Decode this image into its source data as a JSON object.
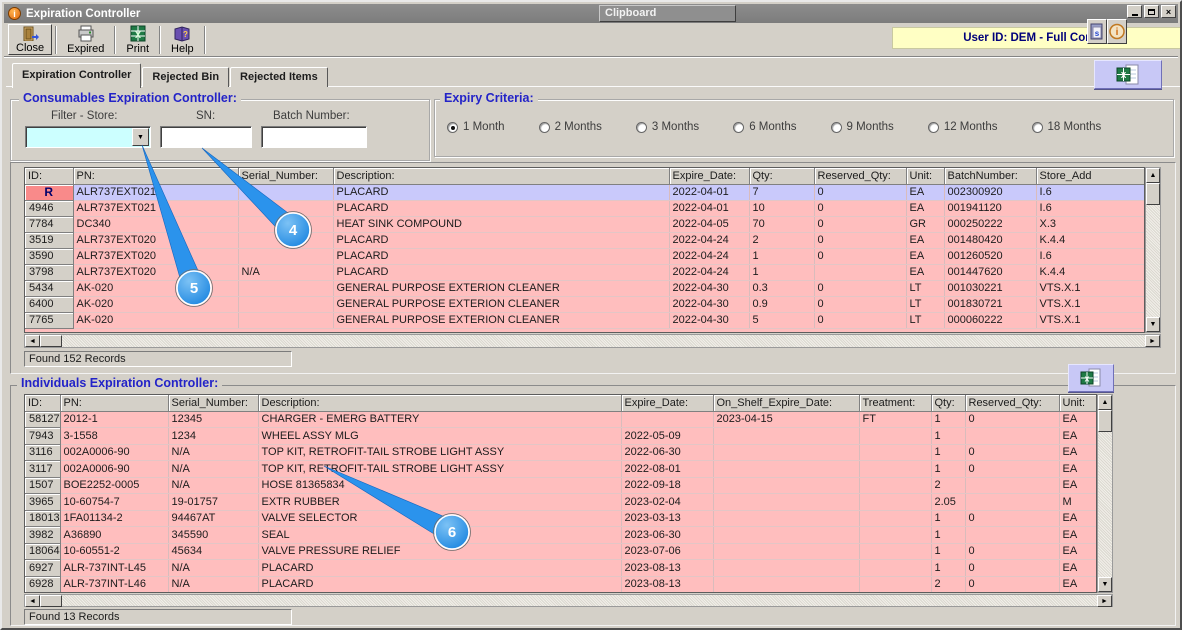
{
  "window": {
    "title": "Expiration Controller",
    "clipboard_title": "Clipboard",
    "user_badge": "User ID: DEM - Full Control"
  },
  "toolbar": {
    "buttons": [
      {
        "label": "Close",
        "icon": "door-exit-icon"
      },
      {
        "label": "Expired",
        "icon": "printer-icon"
      },
      {
        "label": "Print",
        "icon": "excel-icon"
      },
      {
        "label": "Help",
        "icon": "help-book-icon"
      }
    ]
  },
  "tabs": [
    {
      "label": "Expiration Controller",
      "cls": "active"
    },
    {
      "label": "Rejected Bin"
    },
    {
      "label": "Rejected Items"
    }
  ],
  "consumables": {
    "title": "Consumables Expiration Controller:",
    "store_label": "Filter - Store:",
    "store_value": "",
    "sn_label": "SN:",
    "sn_value": "",
    "batch_label": "Batch Number:",
    "batch_value": "",
    "status": "Found 152 Records",
    "columns": [
      "ID:",
      "PN:",
      "Serial_Number:",
      "Description:",
      "Expire_Date:",
      "Qty:",
      "Reserved_Qty:",
      "Unit:",
      "BatchNumber:",
      "Store_Add"
    ],
    "rows": [
      {
        "id": "R",
        "pn": "ALR737EXT021",
        "sn": "",
        "desc": "PLACARD",
        "exp": "2022-04-01",
        "qty": "7",
        "rq": "0",
        "unit": "EA",
        "batch": "002300920",
        "store": "I.6",
        "cls": "selected",
        "idcls": "red"
      },
      {
        "id": "4946",
        "pn": "ALR737EXT021",
        "sn": "",
        "desc": "PLACARD",
        "exp": "2022-04-01",
        "qty": "10",
        "rq": "0",
        "unit": "EA",
        "batch": "001941120",
        "store": "I.6"
      },
      {
        "id": "7784",
        "pn": "DC340",
        "sn": "",
        "desc": "HEAT SINK COMPOUND",
        "exp": "2022-04-05",
        "qty": "70",
        "rq": "0",
        "unit": "GR",
        "batch": "000250222",
        "store": "X.3"
      },
      {
        "id": "3519",
        "pn": "ALR737EXT020",
        "sn": "",
        "desc": "PLACARD",
        "exp": "2022-04-24",
        "qty": "2",
        "rq": "0",
        "unit": "EA",
        "batch": "001480420",
        "store": "K.4.4"
      },
      {
        "id": "3590",
        "pn": "ALR737EXT020",
        "sn": "",
        "desc": "PLACARD",
        "exp": "2022-04-24",
        "qty": "1",
        "rq": "0",
        "unit": "EA",
        "batch": "001260520",
        "store": "I.6"
      },
      {
        "id": "3798",
        "pn": "ALR737EXT020",
        "sn": "N/A",
        "desc": "PLACARD",
        "exp": "2022-04-24",
        "qty": "1",
        "rq": "",
        "unit": "EA",
        "batch": "001447620",
        "store": "K.4.4"
      },
      {
        "id": "5434",
        "pn": "AK-020",
        "sn": "",
        "desc": "GENERAL PURPOSE EXTERION CLEANER",
        "exp": "2022-04-30",
        "qty": "0.3",
        "rq": "0",
        "unit": "LT",
        "batch": "001030221",
        "store": "VTS.X.1"
      },
      {
        "id": "6400",
        "pn": "AK-020",
        "sn": "",
        "desc": "GENERAL PURPOSE EXTERION CLEANER",
        "exp": "2022-04-30",
        "qty": "0.9",
        "rq": "0",
        "unit": "LT",
        "batch": "001830721",
        "store": "VTS.X.1"
      },
      {
        "id": "7765",
        "pn": "AK-020",
        "sn": "",
        "desc": "GENERAL PURPOSE EXTERION CLEANER",
        "exp": "2022-04-30",
        "qty": "5",
        "rq": "0",
        "unit": "LT",
        "batch": "000060222",
        "store": "VTS.X.1"
      }
    ]
  },
  "expiry": {
    "title": "Expiry Criteria:",
    "options": [
      {
        "label": "1 Month",
        "cls": "checked"
      },
      {
        "label": "2 Months"
      },
      {
        "label": "3 Months"
      },
      {
        "label": "6 Months"
      },
      {
        "label": "9 Months"
      },
      {
        "label": "12 Months"
      },
      {
        "label": "18 Months"
      }
    ]
  },
  "individuals": {
    "title": "Individuals Expiration Controller:",
    "status": "Found 13 Records",
    "columns": [
      "ID:",
      "PN:",
      "Serial_Number:",
      "Description:",
      "Expire_Date:",
      "On_Shelf_Expire_Date:",
      "Treatment:",
      "Qty:",
      "Reserved_Qty:",
      "Unit:"
    ],
    "rows": [
      {
        "id": "58127",
        "pn": "2012-1",
        "sn": "12345",
        "desc": "CHARGER - EMERG BATTERY",
        "exp": "",
        "shelf": "2023-04-15",
        "treat": "FT",
        "qty": "1",
        "rq": "0",
        "unit": "EA"
      },
      {
        "id": "7943",
        "pn": "3-1558",
        "sn": "1234",
        "desc": "WHEEL ASSY MLG",
        "exp": "2022-05-09",
        "shelf": "",
        "treat": "",
        "qty": "1",
        "rq": "",
        "unit": "EA"
      },
      {
        "id": "3116",
        "pn": "002A0006-90",
        "sn": "N/A",
        "desc": "TOP KIT, RETROFIT-TAIL STROBE LIGHT ASSY",
        "exp": "2022-06-30",
        "shelf": "",
        "treat": "",
        "qty": "1",
        "rq": "0",
        "unit": "EA"
      },
      {
        "id": "3117",
        "pn": "002A0006-90",
        "sn": "N/A",
        "desc": "TOP KIT, RETROFIT-TAIL STROBE LIGHT ASSY",
        "exp": "2022-08-01",
        "shelf": "",
        "treat": "",
        "qty": "1",
        "rq": "0",
        "unit": "EA"
      },
      {
        "id": "1507",
        "pn": "BOE2252-0005",
        "sn": "N/A",
        "desc": "HOSE 81365834",
        "exp": "2022-09-18",
        "shelf": "",
        "treat": "",
        "qty": "2",
        "rq": "",
        "unit": "EA"
      },
      {
        "id": "3965",
        "pn": "10-60754-7",
        "sn": "19-01757",
        "desc": "EXTR RUBBER",
        "exp": "2023-02-04",
        "shelf": "",
        "treat": "",
        "qty": "2.05",
        "rq": "",
        "unit": "M"
      },
      {
        "id": "18013",
        "pn": "1FA01134-2",
        "sn": "94467AT",
        "desc": "VALVE SELECTOR",
        "exp": "2023-03-13",
        "shelf": "",
        "treat": "",
        "qty": "1",
        "rq": "0",
        "unit": "EA"
      },
      {
        "id": "3982",
        "pn": "A36890",
        "sn": "345590",
        "desc": "SEAL",
        "exp": "2023-06-30",
        "shelf": "",
        "treat": "",
        "qty": "1",
        "rq": "",
        "unit": "EA"
      },
      {
        "id": "18064",
        "pn": "10-60551-2",
        "sn": "45634",
        "desc": "VALVE PRESSURE RELIEF",
        "exp": "2023-07-06",
        "shelf": "",
        "treat": "",
        "qty": "1",
        "rq": "0",
        "unit": "EA"
      },
      {
        "id": "6927",
        "pn": "ALR-737INT-L45",
        "sn": "N/A",
        "desc": "PLACARD",
        "exp": "2023-08-13",
        "shelf": "",
        "treat": "",
        "qty": "1",
        "rq": "0",
        "unit": "EA"
      },
      {
        "id": "6928",
        "pn": "ALR-737INT-L46",
        "sn": "N/A",
        "desc": "PLACARD",
        "exp": "2023-08-13",
        "shelf": "",
        "treat": "",
        "qty": "2",
        "rq": "0",
        "unit": "EA"
      }
    ]
  },
  "callouts": [
    {
      "n": "4"
    },
    {
      "n": "5"
    },
    {
      "n": "6"
    }
  ],
  "colors": {
    "callout_blue": "#2b93ec",
    "row_pink": "#ffbebe",
    "selected_lavender": "#c9c9fb",
    "badge_yellow": "#ffffc4",
    "store_cyan": "#ccffff",
    "section_title_blue": "#2323c8",
    "red_marker": "#f98a8a"
  }
}
